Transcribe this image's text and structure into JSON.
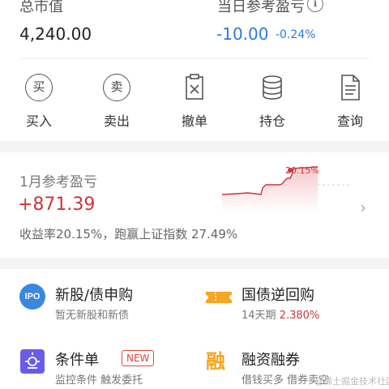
{
  "summary": {
    "total_label": "总市值",
    "total_value": "4,240.00",
    "day_pl_label": "当日参考盈亏",
    "day_pl_value": "-10.00",
    "day_pl_pct": "-0.24%"
  },
  "actions": [
    {
      "label": "买入",
      "icon": "buy-icon",
      "glyph": "买"
    },
    {
      "label": "卖出",
      "icon": "sell-icon",
      "glyph": "卖"
    },
    {
      "label": "撤单",
      "icon": "cancel-order-icon"
    },
    {
      "label": "持仓",
      "icon": "holdings-icon"
    },
    {
      "label": "查询",
      "icon": "query-icon"
    }
  ],
  "monthly": {
    "title": "1月参考盈亏",
    "value": "+871.39",
    "subtitle": "收益率20.15%，跑赢上证指数 27.49%",
    "chart_label": "20.15%"
  },
  "services": {
    "ipo": {
      "icon_text": "IPO",
      "title": "新股/债申购",
      "subtitle": "暂无新股和新债"
    },
    "repo": {
      "title": "国债逆回购",
      "sub_term": "14天期",
      "sub_rate": "2.380%"
    },
    "condition": {
      "title": "条件单",
      "badge": "NEW",
      "subtitle": "监控条件 触发委托"
    },
    "margin": {
      "icon_text": "融",
      "title": "融资融券",
      "subtitle": "借钱买多 借券卖空"
    }
  },
  "watermark": "@稀土掘金技术社区",
  "colors": {
    "rise": "#d0333b",
    "fall": "#2e7ad6",
    "accent": "#f5a623"
  }
}
